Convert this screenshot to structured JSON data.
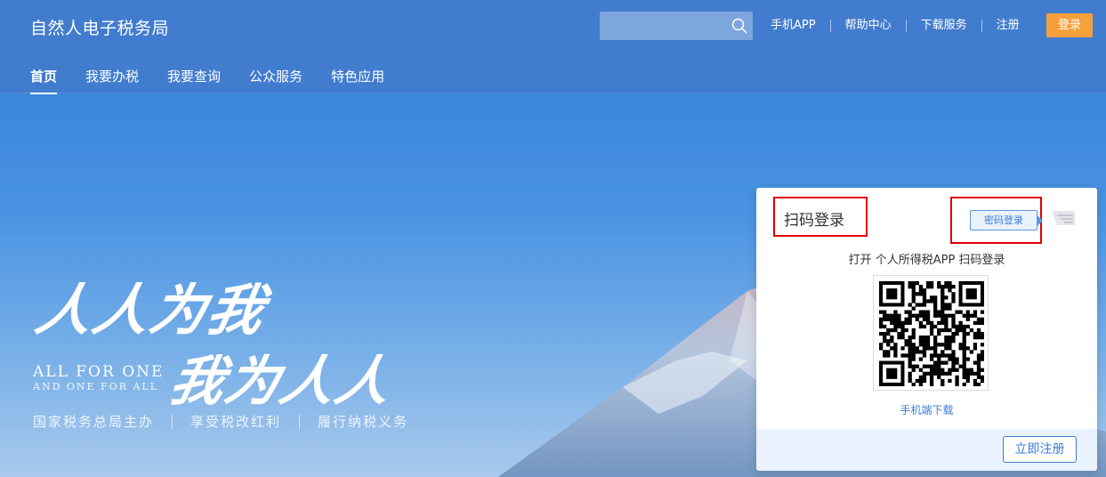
{
  "header": {
    "title": "自然人电子税务局",
    "search_placeholder": "",
    "links": [
      "手机APP",
      "帮助中心",
      "下载服务",
      "注册"
    ],
    "login_label": "登录"
  },
  "nav": {
    "items": [
      "首页",
      "我要办税",
      "我要查询",
      "公众服务",
      "特色应用"
    ],
    "active": "首页"
  },
  "hero": {
    "slogan_line1": "人人为我",
    "slogan_line2": "我为人人",
    "slogan_en1": "ALL FOR ONE",
    "slogan_en2": "AND ONE FOR ALL",
    "taglines": [
      "国家税务总局主办",
      "享受税改红利",
      "履行纳税义务"
    ]
  },
  "login_card": {
    "title": "扫码登录",
    "password_login_label": "密码登录",
    "scan_hint": "打开 个人所得税APP 扫码登录",
    "download_link": "手机端下载",
    "register_label": "立即注册"
  },
  "colors": {
    "header_bg": "#427ccd",
    "login_btn": "#f6a03b",
    "accent": "#3a7bd5",
    "highlight_border": "#e00000"
  }
}
